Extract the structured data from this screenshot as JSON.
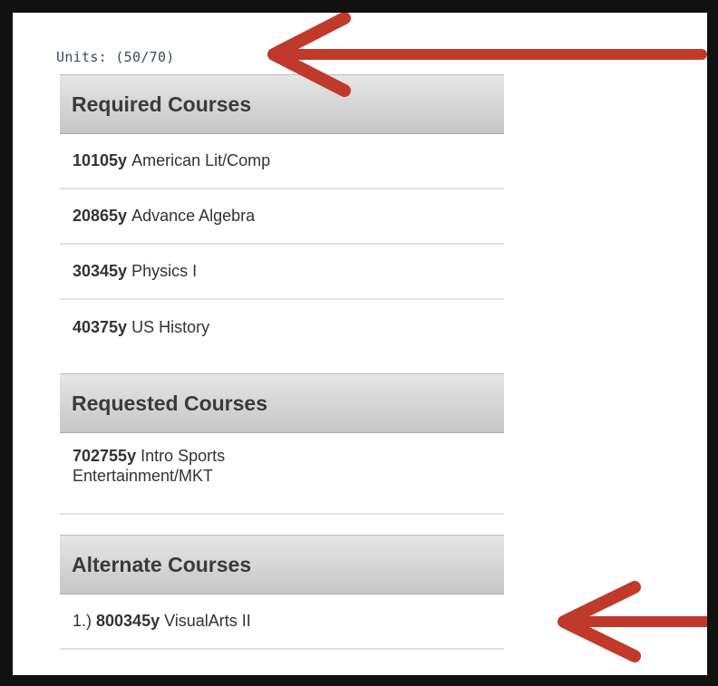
{
  "units": {
    "label": "Units: (50/70)"
  },
  "sections": [
    {
      "title": "Required Courses",
      "items": [
        {
          "code": "10105y",
          "name": "American Lit/Comp"
        },
        {
          "code": "20865y",
          "name": "Advance Algebra"
        },
        {
          "code": "30345y",
          "name": "Physics I"
        },
        {
          "code": "40375y",
          "name": "US History"
        }
      ]
    },
    {
      "title": "Requested Courses",
      "items": [
        {
          "code": "702755y",
          "name": "Intro Sports",
          "name_line2": "Entertainment/MKT"
        }
      ]
    },
    {
      "title": "Alternate Courses",
      "items": [
        {
          "prefix": "1.)",
          "code": "800345y",
          "name": "VisualArts II"
        }
      ]
    }
  ],
  "colors": {
    "frame_bg": "#111111",
    "arrow": "#c0392b",
    "header_bg": "#d6d6d6"
  },
  "annotations": [
    "arrow-pointing-units",
    "arrow-pointing-alternate-course"
  ]
}
